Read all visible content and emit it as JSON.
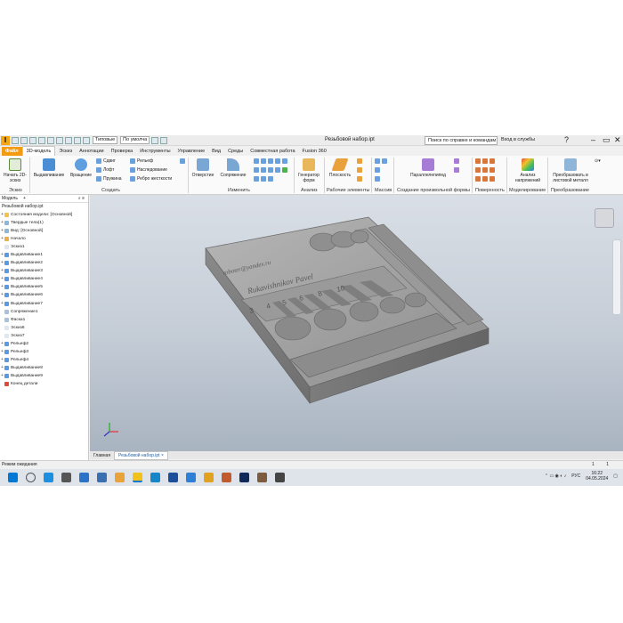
{
  "qat": {
    "logo": "I",
    "material": "Типовые",
    "appearance": "По умолча",
    "doc_title": "Резьбовой набор.ipt",
    "help_search": "Поиск по справке и командам",
    "sign_in": "Вход в службы",
    "help": "?"
  },
  "tabs": [
    "Файл",
    "3D-модель",
    "Эскиз",
    "Аннотации",
    "Проверка",
    "Инструменты",
    "Управление",
    "Вид",
    "Среды",
    "Совместная работа",
    "Fusion 360"
  ],
  "ribbon": {
    "sketch": {
      "start": "Начать 2D-эскиз",
      "group": "Эскиз"
    },
    "create": {
      "extrude": "Выдавливание",
      "revolve": "Вращение",
      "sweep": "Сдвиг",
      "loft": "Лофт",
      "coil": "Пружина",
      "emboss": "Рельеф",
      "derive": "Наследование",
      "rib": "Ребро жесткости",
      "group": "Создать"
    },
    "modify": {
      "fillet": "Отверстие",
      "chamfer": "Сопряжение",
      "group": "Изменить"
    },
    "explore": {
      "generator": "Генератор форм",
      "group": "Анализ"
    },
    "work": {
      "plane": "Плоскость",
      "group": "Рабочие элементы"
    },
    "pattern": {
      "group": "Массив"
    },
    "freeform": {
      "box": "Параллелепипед",
      "group": "Создание произвольной формы"
    },
    "surface": {
      "group": "Поверхность"
    },
    "simulation": {
      "stress": "Анализ напряжений",
      "group": "Моделирование"
    },
    "convert": {
      "sheet": "Преобразовать в листовой металл",
      "group": "Преобразование"
    }
  },
  "browser": {
    "tab": "Модель",
    "plus": "+",
    "root": "Резьбовой набор.ipt",
    "items": [
      "Состояния модели: [Основной]",
      "Твердые тела(1)",
      "Вид: [Основной]",
      "Начало",
      "Эскиз1",
      "Выдавливание1",
      "Выдавливание2",
      "Выдавливание3",
      "Выдавливание4",
      "Выдавливание5",
      "Выдавливание6",
      "Выдавливание7",
      "Сопряжение1",
      "Фаска1",
      "Эскиз6",
      "Эскиз7",
      "Рельеф2",
      "Рельеф3",
      "Рельеф4",
      "Выдавливание8",
      "Выдавливание9",
      "Конец детали"
    ]
  },
  "model": {
    "engraving_1": "Rukavishnikov Pavel",
    "engraving_2": "roboter@yandex.ru",
    "slot_labels": [
      "3",
      "4",
      "5",
      "6",
      "8",
      "10"
    ]
  },
  "doctabs": {
    "home": "Главная",
    "active": "Резьбовой набор.ipt"
  },
  "status": {
    "text": "Режим ожидания",
    "n1": "1",
    "n2": "1"
  },
  "taskbar": {
    "lang": "РУС",
    "time": "16:22",
    "date": "04.05.2024"
  },
  "colors": {
    "accent": "#f39c12",
    "file_tab": "#f39c12",
    "model_gray": "#9a9a9a"
  }
}
